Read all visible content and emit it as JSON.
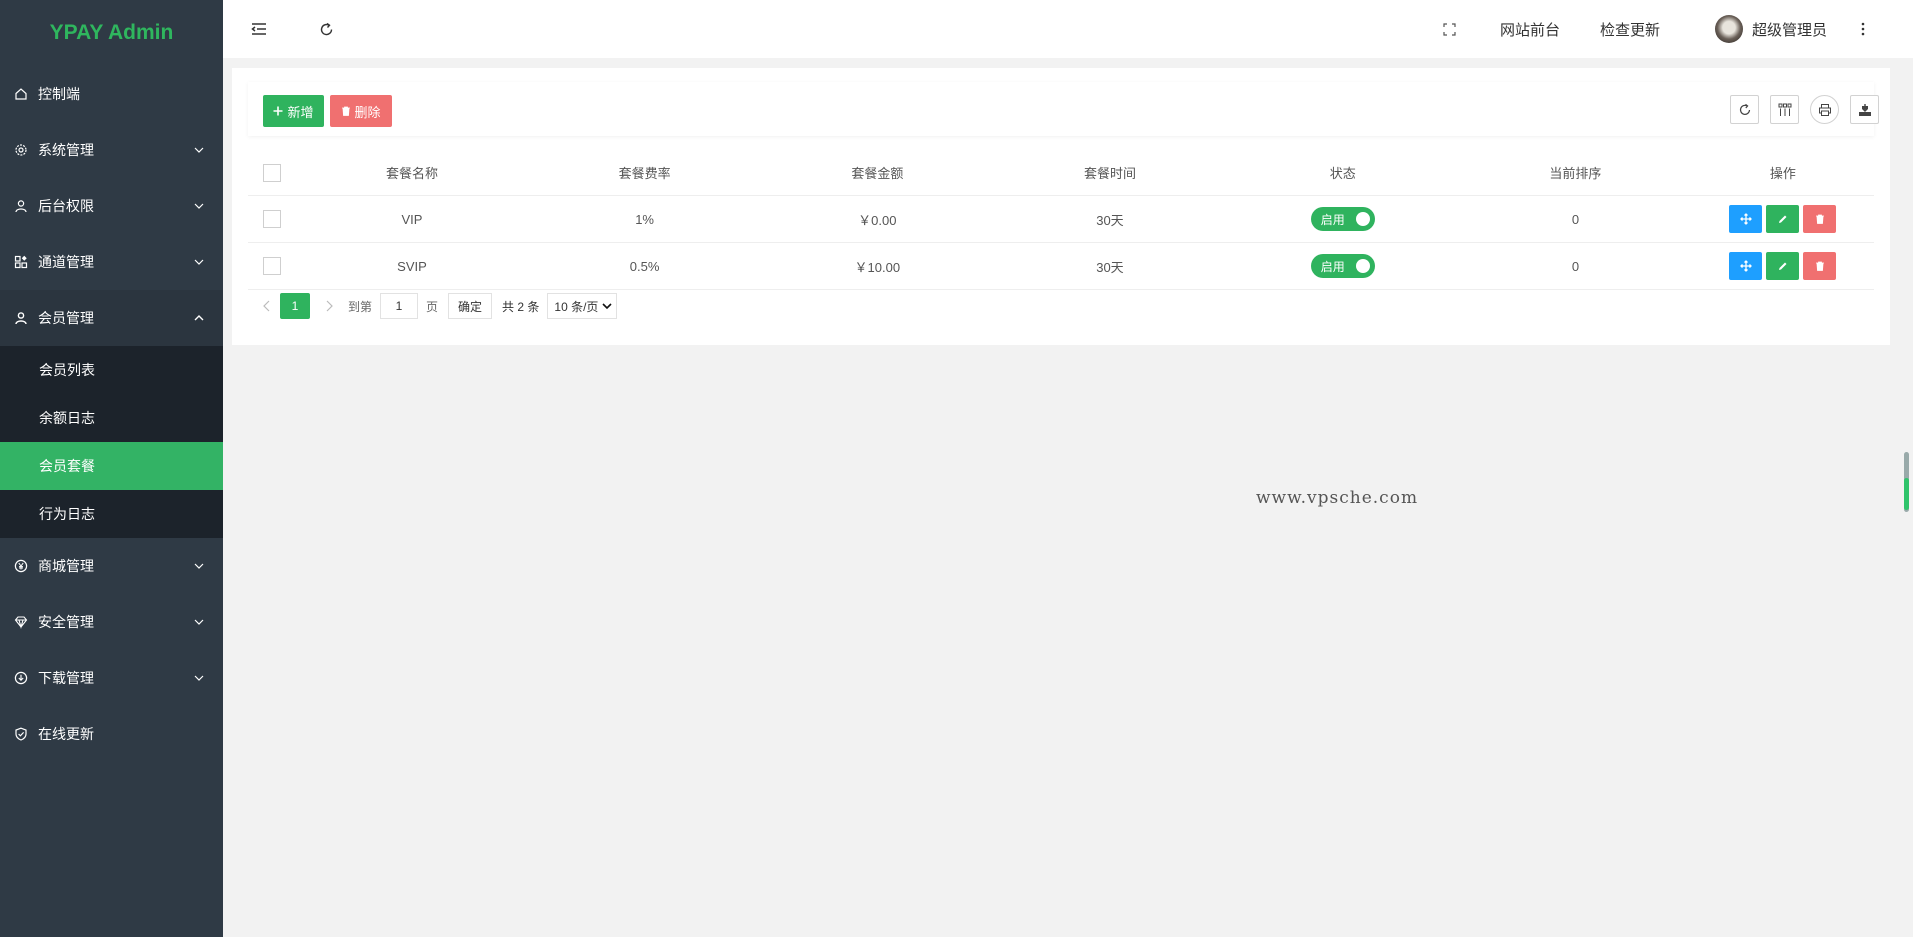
{
  "app": {
    "title": "YPAY Admin"
  },
  "sidebar": {
    "items": [
      {
        "label": "控制端",
        "icon": "home-icon"
      },
      {
        "label": "系统管理",
        "icon": "gear-icon"
      },
      {
        "label": "后台权限",
        "icon": "user-icon"
      },
      {
        "label": "通道管理",
        "icon": "apps-icon"
      },
      {
        "label": "会员管理",
        "icon": "user-icon"
      },
      {
        "label": "商城管理",
        "icon": "yen-icon"
      },
      {
        "label": "安全管理",
        "icon": "diamond-icon"
      },
      {
        "label": "下载管理",
        "icon": "download-icon"
      },
      {
        "label": "在线更新",
        "icon": "shield-check-icon"
      }
    ],
    "member_sub": [
      {
        "label": "会员列表"
      },
      {
        "label": "余额日志"
      },
      {
        "label": "会员套餐",
        "active": true
      },
      {
        "label": "行为日志"
      }
    ]
  },
  "header": {
    "frontend": "网站前台",
    "check_update": "检查更新",
    "username": "超级管理员"
  },
  "toolbar": {
    "add_label": "新增",
    "delete_label": "删除"
  },
  "table": {
    "columns": [
      "套餐名称",
      "套餐费率",
      "套餐金额",
      "套餐时间",
      "状态",
      "当前排序",
      "操作"
    ],
    "rows": [
      {
        "name": "VIP",
        "rate": "1%",
        "amount": "￥0.00",
        "time": "30天",
        "status": "启用",
        "sort": "0"
      },
      {
        "name": "SVIP",
        "rate": "0.5%",
        "amount": "￥10.00",
        "time": "30天",
        "status": "启用",
        "sort": "0"
      }
    ]
  },
  "pagination": {
    "current": "1",
    "goto_label": "到第",
    "goto_value": "1",
    "page_label": "页",
    "confirm": "确定",
    "total": "共 2 条",
    "per_page": "10 条/页"
  },
  "watermark": "www.vpsche.com",
  "colors": {
    "accent": "#2fb35e",
    "danger": "#f07070",
    "info": "#1e9fff",
    "sidebar": "#2f3a45"
  }
}
